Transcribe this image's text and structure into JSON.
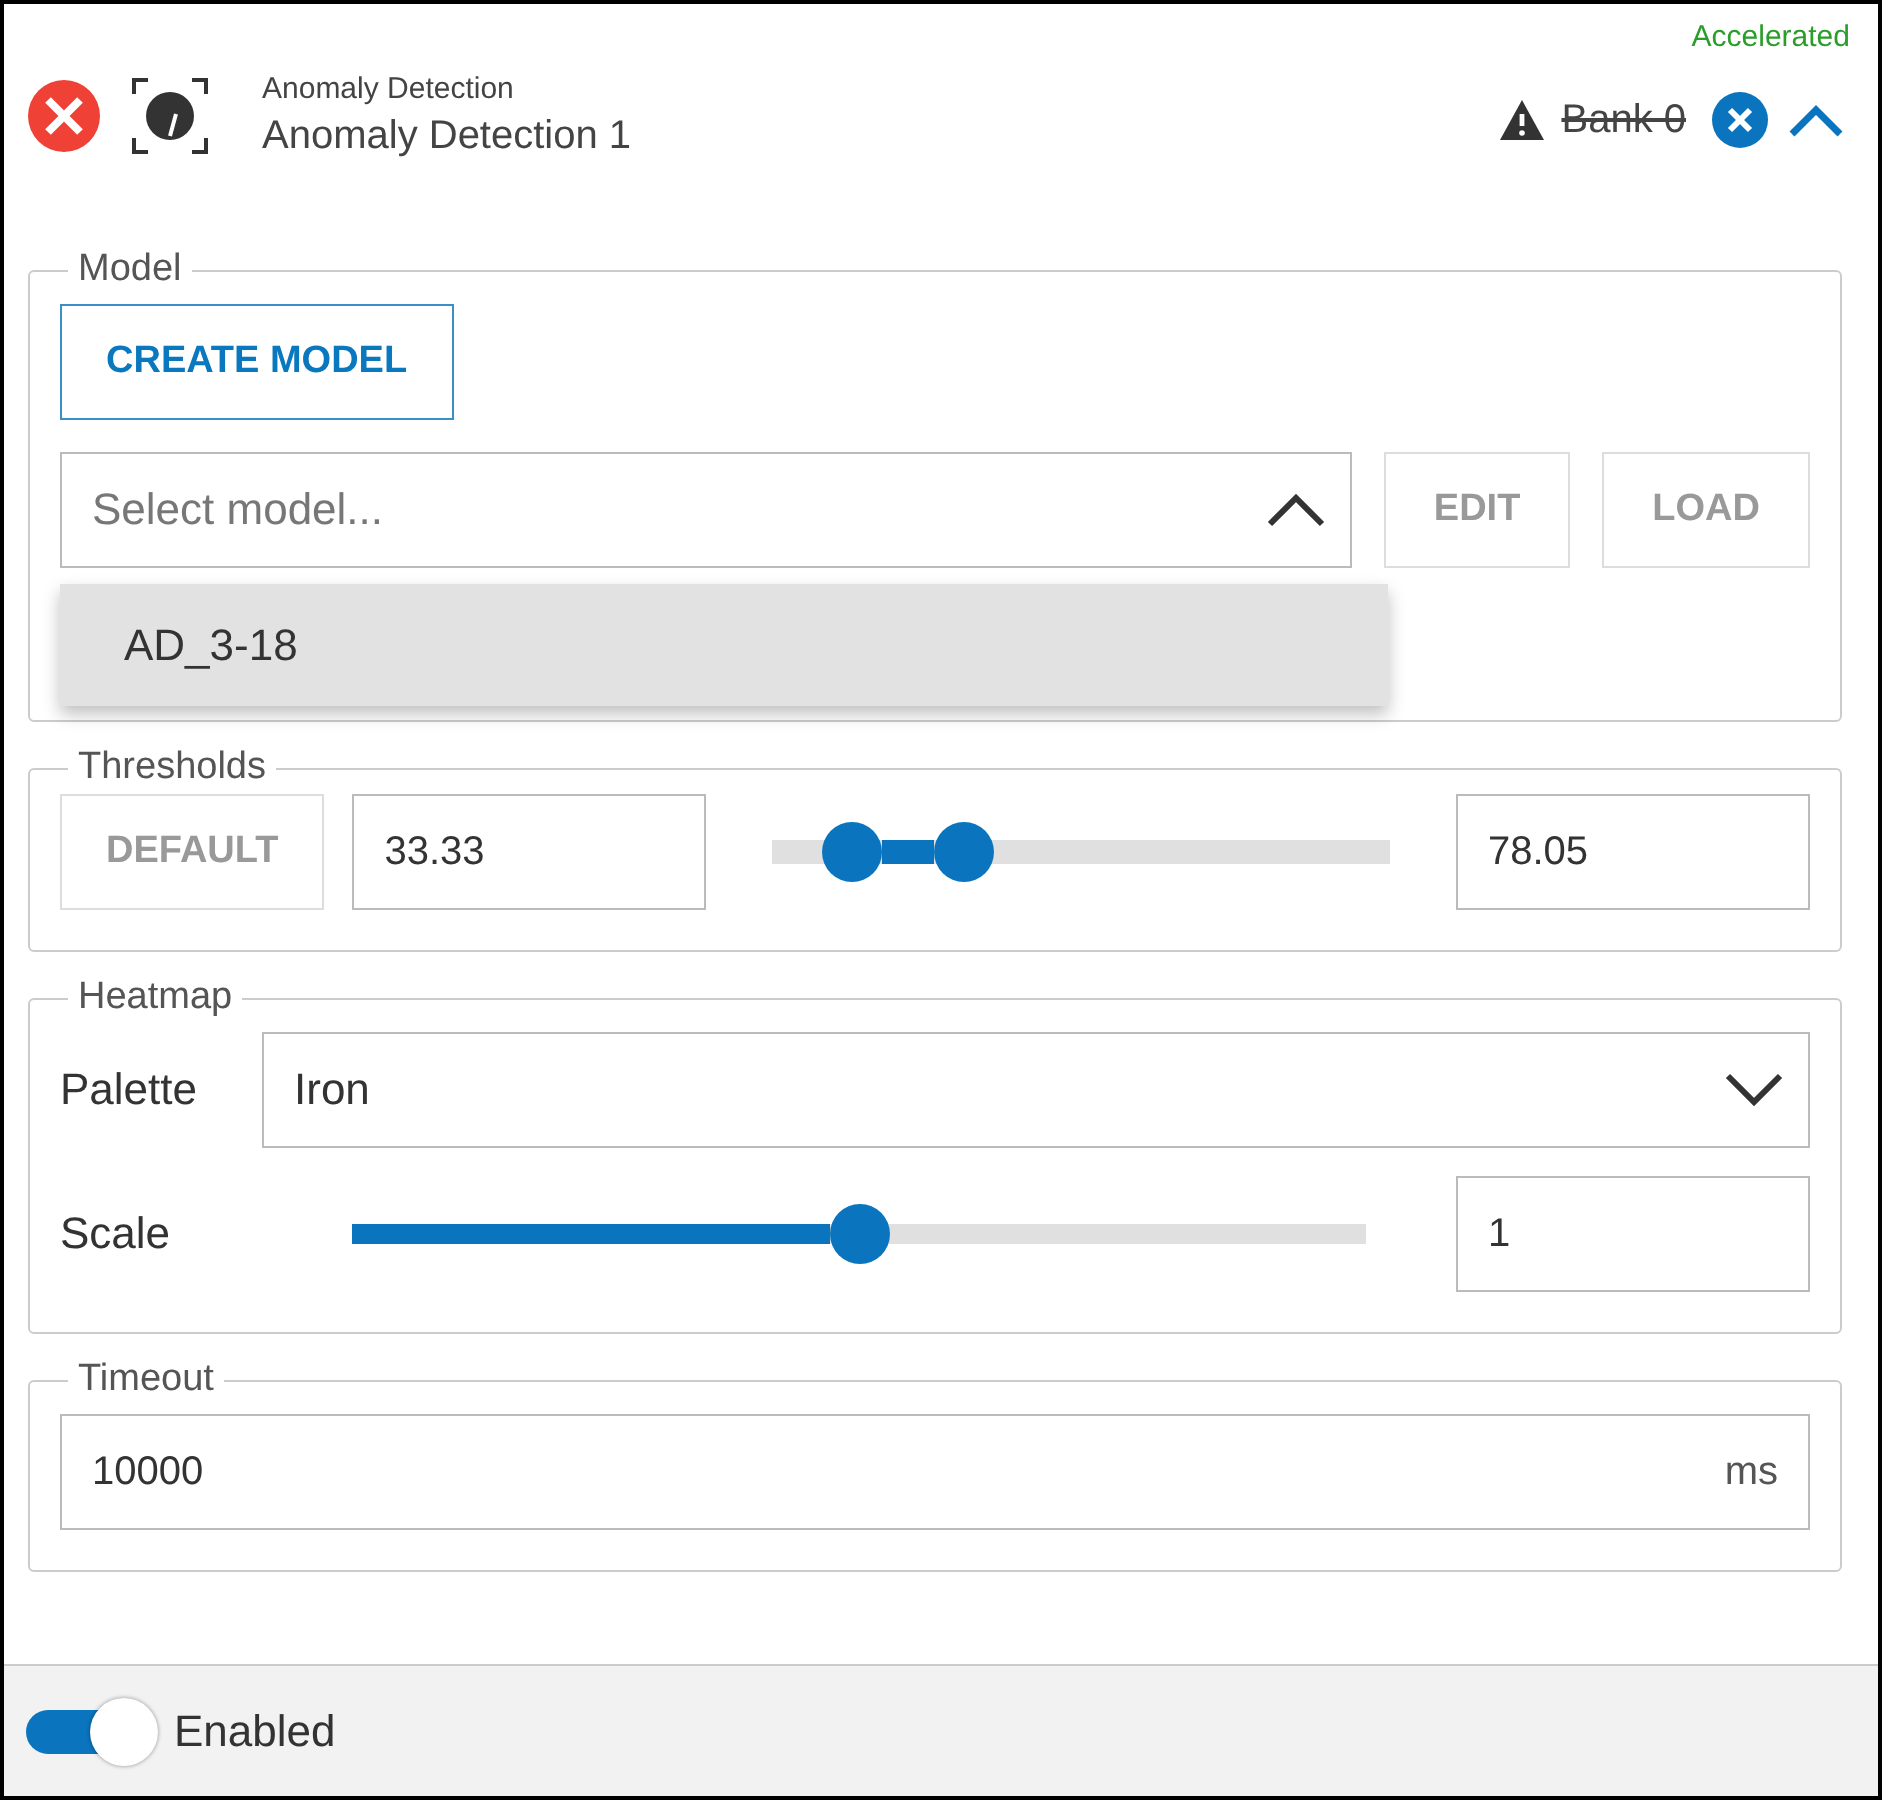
{
  "header": {
    "category": "Anomaly Detection",
    "title": "Anomaly Detection 1",
    "status": "Accelerated",
    "bank": {
      "label": "Bank 0",
      "unavailable": true
    },
    "expanded": true
  },
  "model": {
    "legend": "Model",
    "create_button": "CREATE MODEL",
    "select": {
      "placeholder": "Select model...",
      "open": true,
      "options": [
        {
          "label": "AD_3-18",
          "highlighted": true
        }
      ]
    },
    "buttons": [
      {
        "label": "EDIT",
        "disabled": true
      },
      {
        "label": "LOAD",
        "disabled": true
      }
    ]
  },
  "thresholds": {
    "legend": "Thresholds",
    "default_button": {
      "label": "DEFAULT",
      "disabled": true
    },
    "low": {
      "value": "33.33",
      "level": 0.13
    },
    "high": {
      "value": "78.05",
      "level": 0.31
    }
  },
  "heatmap": {
    "legend": "Heatmap",
    "palette": {
      "label": "Palette",
      "value": "Iron"
    },
    "scale": {
      "label": "Scale",
      "level": 0.5,
      "value": "1"
    }
  },
  "timeout": {
    "legend": "Timeout",
    "value": "10000",
    "unit": "ms"
  },
  "footer": {
    "toggle": {
      "label": "Enabled",
      "on": true
    }
  }
}
